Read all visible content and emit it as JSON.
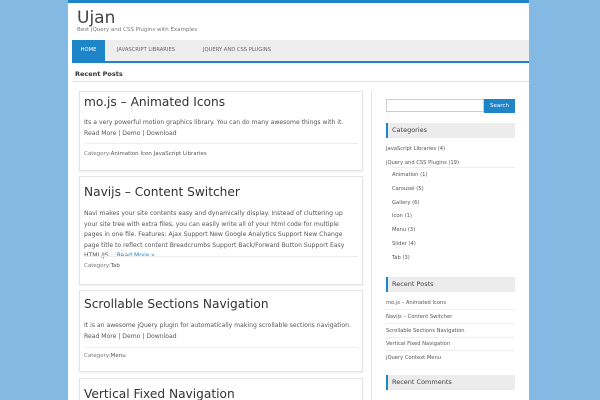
{
  "site": {
    "title": "Ujan",
    "description": "Best jQuery and CSS Plugins with Examples"
  },
  "nav": {
    "items": [
      {
        "label": "HOME"
      },
      {
        "label": "JAVASCRIPT LIBRARIES"
      },
      {
        "label": "JQUERY AND CSS PLUGINS"
      }
    ]
  },
  "main": {
    "section_title": "Recent Posts",
    "posts": [
      {
        "title": "mo.js – Animated Icons",
        "excerpt": "Its a very powerful motion graphics library. You can do many awesome things with it. Read More | Demo | Download",
        "category_label": "Category:",
        "categories": "Animation  Icon  JavaScript Libraries"
      },
      {
        "title": "Navijs – Content Switcher",
        "excerpt": "Navi makes your site contents easy and dynamically display. Instead of cluttering up your site tree with extra files, you can easily write all of your html code for multiple pages in one file. Features: Ajax Support New Google Analytics Support New Change page title to reflect content Breadcrumbs Support Back/Forward Button Support Easy HTML/JS…",
        "more": "Read More »",
        "category_label": "Category:",
        "categories": "Tab"
      },
      {
        "title": "Scrollable Sections Navigation",
        "excerpt": "It is an awesome jQuery plugin for automatically making scrollable sections navigation. Read More | Demo | Download",
        "category_label": "Category:",
        "categories": "Menu"
      },
      {
        "title": "Vertical Fixed Navigation"
      }
    ]
  },
  "sidebar": {
    "search": {
      "placeholder": "",
      "button": "Search"
    },
    "categories": {
      "title": "Categories",
      "items": [
        {
          "label": "JavaScript Libraries (4)"
        },
        {
          "label": "jQuery and CSS Plugins (19)"
        },
        {
          "label": "Animation (1)"
        },
        {
          "label": "Carousel (5)"
        },
        {
          "label": "Gallery (6)"
        },
        {
          "label": "Icon (1)"
        },
        {
          "label": "Menu (3)"
        },
        {
          "label": "Slider (4)"
        },
        {
          "label": "Tab (3)"
        }
      ]
    },
    "recent_posts": {
      "title": "Recent Posts",
      "items": [
        {
          "label": "mo.js – Animated Icons"
        },
        {
          "label": "Navijs – Content Switcher"
        },
        {
          "label": "Scrollable Sections Navigation"
        },
        {
          "label": "Vertical Fixed Navigation"
        },
        {
          "label": "jQuery Context Menu"
        }
      ]
    },
    "recent_comments": {
      "title": "Recent Comments"
    }
  },
  "colors": {
    "accent": "#1e86c8",
    "background": "#83b9e3",
    "panel": "#ececec"
  }
}
